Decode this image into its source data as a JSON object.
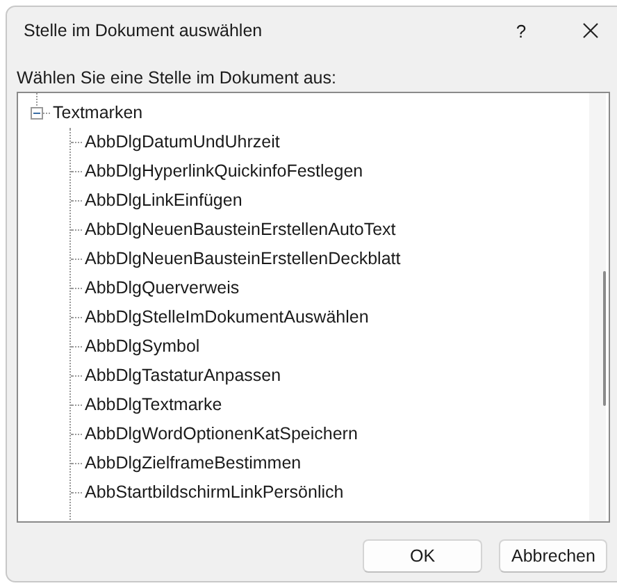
{
  "window": {
    "title": "Stelle im Dokument auswählen",
    "help_button": "?"
  },
  "prompt": "Wählen Sie eine Stelle im Dokument aus:",
  "tree": [
    {
      "label": "Textmarken",
      "expanded": true,
      "children": [
        {
          "label": "AbbDlgDatumUndUhrzeit"
        },
        {
          "label": "AbbDlgHyperlinkQuickinfoFestlegen"
        },
        {
          "label": "AbbDlgLinkEinfügen"
        },
        {
          "label": "AbbDlgNeuenBausteinErstellenAutoText"
        },
        {
          "label": "AbbDlgNeuenBausteinErstellenDeckblatt"
        },
        {
          "label": "AbbDlgQuerverweis"
        },
        {
          "label": "AbbDlgStelleImDokumentAuswählen"
        },
        {
          "label": "AbbDlgSymbol"
        },
        {
          "label": "AbbDlgTastaturAnpassen"
        },
        {
          "label": "AbbDlgTextmarke"
        },
        {
          "label": "AbbDlgWordOptionenKatSpeichern"
        },
        {
          "label": "AbbDlgZielframeBestimmen"
        },
        {
          "label": "AbbStartbildschirmLinkPersönlich"
        }
      ]
    }
  ],
  "buttons": [
    "OK",
    "Abbrechen"
  ]
}
